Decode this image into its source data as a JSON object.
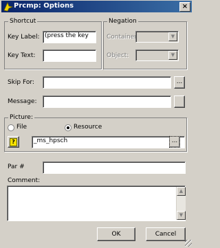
{
  "window": {
    "title": "Prcmp: Options",
    "close_label": "×"
  },
  "shortcut": {
    "group_label": "Shortcut",
    "key_label_label": "Key Label:",
    "key_label_value": "(press the key",
    "key_text_label": "Key Text:",
    "key_text_value": ""
  },
  "negation": {
    "group_label": "Negation",
    "container_label": "Container:",
    "object_label": "Object:"
  },
  "skip_for": {
    "label": "Skip For:",
    "value": "",
    "browse_label": "..."
  },
  "message": {
    "label": "Message:",
    "value": ""
  },
  "picture": {
    "group_label": "Picture:",
    "file_label": "File",
    "resource_label": "Resource",
    "selected": "Resource",
    "value": "_ms_hpsch",
    "help_icon_glyph": "?",
    "browse_label": "..."
  },
  "par": {
    "label": "Par #",
    "value": ""
  },
  "comment": {
    "label": "Comment:",
    "value": "",
    "scroll_up_glyph": "▲",
    "scroll_down_glyph": "▼"
  },
  "buttons": {
    "ok_label": "OK",
    "cancel_label": "Cancel"
  },
  "icons": {
    "title": "prompt-icon",
    "help": "help-icon",
    "close": "close-icon"
  }
}
